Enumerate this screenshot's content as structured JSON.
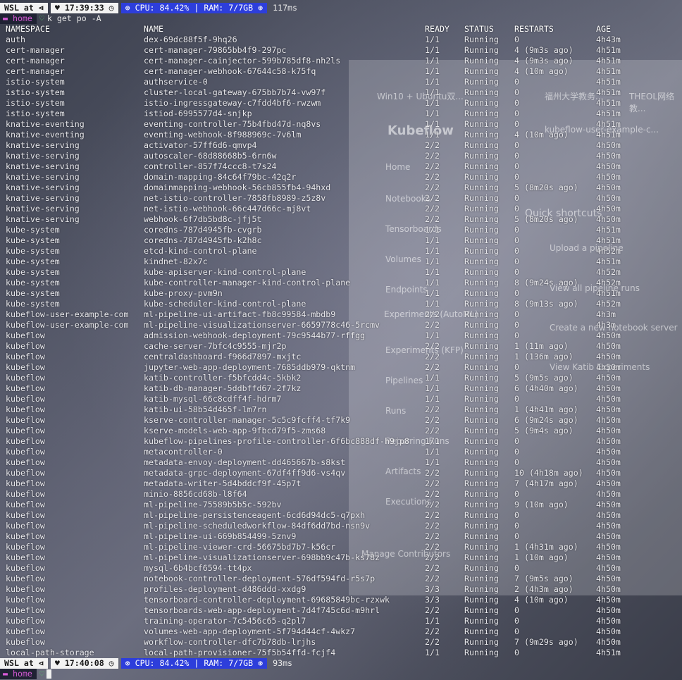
{
  "prompt_top": {
    "wsl": "WSL at",
    "clock": "17:39:33",
    "cpu": "CPU: 84.42% | RAM: 7/7GB",
    "elapsed": "117ms",
    "home": "home",
    "command": "k get po -A"
  },
  "prompt_bottom": {
    "wsl": "WSL at",
    "clock": "17:40:08",
    "cpu": "CPU: 84.42% | RAM: 7/7GB",
    "elapsed": "93ms",
    "home": "home"
  },
  "columns": [
    "NAMESPACE",
    "NAME",
    "READY",
    "STATUS",
    "RESTARTS",
    "AGE"
  ],
  "pods": [
    [
      "auth",
      "dex-69dc88f5f-9hq26",
      "1/1",
      "Running",
      "0",
      "4h43m"
    ],
    [
      "cert-manager",
      "cert-manager-79865bb4f9-297pc",
      "1/1",
      "Running",
      "4 (9m3s ago)",
      "4h51m"
    ],
    [
      "cert-manager",
      "cert-manager-cainjector-599b785df8-nh2ls",
      "1/1",
      "Running",
      "4 (9m3s ago)",
      "4h51m"
    ],
    [
      "cert-manager",
      "cert-manager-webhook-67644c58-k75fq",
      "1/1",
      "Running",
      "4 (10m ago)",
      "4h51m"
    ],
    [
      "istio-system",
      "authservice-0",
      "1/1",
      "Running",
      "0",
      "4h51m"
    ],
    [
      "istio-system",
      "cluster-local-gateway-675bb7b74-vw97f",
      "1/1",
      "Running",
      "0",
      "4h51m"
    ],
    [
      "istio-system",
      "istio-ingressgateway-c7fdd4bf6-rwzwm",
      "1/1",
      "Running",
      "0",
      "4h51m"
    ],
    [
      "istio-system",
      "istiod-6995577d4-snjkp",
      "1/1",
      "Running",
      "0",
      "4h51m"
    ],
    [
      "knative-eventing",
      "eventing-controller-75b4fbd47d-nq8vs",
      "1/1",
      "Running",
      "0",
      "4h51m"
    ],
    [
      "knative-eventing",
      "eventing-webhook-8f988969c-7v6lm",
      "1/1",
      "Running",
      "4 (10m ago)",
      "4h51m"
    ],
    [
      "knative-serving",
      "activator-57ff6d6-qmvp4",
      "2/2",
      "Running",
      "0",
      "4h50m"
    ],
    [
      "knative-serving",
      "autoscaler-68d88668b5-6rn6w",
      "2/2",
      "Running",
      "0",
      "4h50m"
    ],
    [
      "knative-serving",
      "controller-857f74ccc8-t7s24",
      "2/2",
      "Running",
      "0",
      "4h50m"
    ],
    [
      "knative-serving",
      "domain-mapping-84c64f79bc-42q2r",
      "2/2",
      "Running",
      "0",
      "4h50m"
    ],
    [
      "knative-serving",
      "domainmapping-webhook-56cb855fb4-94hxd",
      "2/2",
      "Running",
      "5 (8m20s ago)",
      "4h50m"
    ],
    [
      "knative-serving",
      "net-istio-controller-7858fb8989-z5z8v",
      "2/2",
      "Running",
      "0",
      "4h50m"
    ],
    [
      "knative-serving",
      "net-istio-webhook-66c447d66c-mj8vt",
      "2/2",
      "Running",
      "0",
      "4h50m"
    ],
    [
      "knative-serving",
      "webhook-6f7db5bd8c-jfj5t",
      "2/2",
      "Running",
      "5 (8m20s ago)",
      "4h50m"
    ],
    [
      "kube-system",
      "coredns-787d4945fb-cvgrb",
      "1/1",
      "Running",
      "0",
      "4h51m"
    ],
    [
      "kube-system",
      "coredns-787d4945fb-k2h8c",
      "1/1",
      "Running",
      "0",
      "4h51m"
    ],
    [
      "kube-system",
      "etcd-kind-control-plane",
      "1/1",
      "Running",
      "0",
      "4h52m"
    ],
    [
      "kube-system",
      "kindnet-82x7c",
      "1/1",
      "Running",
      "0",
      "4h51m"
    ],
    [
      "kube-system",
      "kube-apiserver-kind-control-plane",
      "1/1",
      "Running",
      "0",
      "4h52m"
    ],
    [
      "kube-system",
      "kube-controller-manager-kind-control-plane",
      "1/1",
      "Running",
      "8 (9m24s ago)",
      "4h52m"
    ],
    [
      "kube-system",
      "kube-proxy-pvm9n",
      "1/1",
      "Running",
      "0",
      "4h51m"
    ],
    [
      "kube-system",
      "kube-scheduler-kind-control-plane",
      "1/1",
      "Running",
      "8 (9m13s ago)",
      "4h52m"
    ],
    [
      "kubeflow-user-example-com",
      "ml-pipeline-ui-artifact-fb8c99584-mbdb9",
      "2/2",
      "Running",
      "0",
      "4h3m"
    ],
    [
      "kubeflow-user-example-com",
      "ml-pipeline-visualizationserver-6659778c46-5rcmv",
      "2/2",
      "Running",
      "0",
      "4h3m"
    ],
    [
      "kubeflow",
      "admission-webhook-deployment-79c9544b77-rffgg",
      "1/1",
      "Running",
      "0",
      "4h50m"
    ],
    [
      "kubeflow",
      "cache-server-7bfc4c9555-mjr2p",
      "2/2",
      "Running",
      "1 (11m ago)",
      "4h50m"
    ],
    [
      "kubeflow",
      "centraldashboard-f966d7897-mxjtc",
      "2/2",
      "Running",
      "1 (136m ago)",
      "4h50m"
    ],
    [
      "kubeflow",
      "jupyter-web-app-deployment-7685ddb979-qktnm",
      "2/2",
      "Running",
      "0",
      "4h50m"
    ],
    [
      "kubeflow",
      "katib-controller-f5bfcdd4c-5kbk2",
      "1/1",
      "Running",
      "5 (9m5s ago)",
      "4h50m"
    ],
    [
      "kubeflow",
      "katib-db-manager-5ddbffd67-2f7kz",
      "1/1",
      "Running",
      "6 (4h40m ago)",
      "4h50m"
    ],
    [
      "kubeflow",
      "katib-mysql-66c8cdff4f-hdrm7",
      "1/1",
      "Running",
      "0",
      "4h50m"
    ],
    [
      "kubeflow",
      "katib-ui-58b54d465f-lm7rn",
      "2/2",
      "Running",
      "1 (4h41m ago)",
      "4h50m"
    ],
    [
      "kubeflow",
      "kserve-controller-manager-5c5c9fcff4-tf7k9",
      "2/2",
      "Running",
      "6 (9m24s ago)",
      "4h50m"
    ],
    [
      "kubeflow",
      "kserve-models-web-app-9fbcd79f5-zms68",
      "2/2",
      "Running",
      "5 (9m4s ago)",
      "4h50m"
    ],
    [
      "kubeflow",
      "kubeflow-pipelines-profile-controller-6f6bc888df-h9jp8",
      "1/1",
      "Running",
      "0",
      "4h50m"
    ],
    [
      "kubeflow",
      "metacontroller-0",
      "1/1",
      "Running",
      "0",
      "4h50m"
    ],
    [
      "kubeflow",
      "metadata-envoy-deployment-dd465667b-s8kst",
      "1/1",
      "Running",
      "0",
      "4h50m"
    ],
    [
      "kubeflow",
      "metadata-grpc-deployment-67df4ff9d6-vs4qv",
      "2/2",
      "Running",
      "10 (4h18m ago)",
      "4h50m"
    ],
    [
      "kubeflow",
      "metadata-writer-5d4bddcf9f-45p7t",
      "2/2",
      "Running",
      "7 (4h17m ago)",
      "4h50m"
    ],
    [
      "kubeflow",
      "minio-8856cd68b-l8f64",
      "2/2",
      "Running",
      "0",
      "4h50m"
    ],
    [
      "kubeflow",
      "ml-pipeline-75589b5b5c-592bv",
      "2/2",
      "Running",
      "9 (10m ago)",
      "4h50m"
    ],
    [
      "kubeflow",
      "ml-pipeline-persistenceagent-6cd6d94dc5-q7pxh",
      "2/2",
      "Running",
      "0",
      "4h50m"
    ],
    [
      "kubeflow",
      "ml-pipeline-scheduledworkflow-84df6dd7bd-nsn9v",
      "2/2",
      "Running",
      "0",
      "4h50m"
    ],
    [
      "kubeflow",
      "ml-pipeline-ui-669b854499-5znv9",
      "2/2",
      "Running",
      "0",
      "4h50m"
    ],
    [
      "kubeflow",
      "ml-pipeline-viewer-crd-56675bd7b7-k56cr",
      "2/2",
      "Running",
      "1 (4h31m ago)",
      "4h50m"
    ],
    [
      "kubeflow",
      "ml-pipeline-visualizationserver-698bb9c47b-ks78z",
      "2/2",
      "Running",
      "1 (10m ago)",
      "4h50m"
    ],
    [
      "kubeflow",
      "mysql-6b4bcf6594-tt4px",
      "2/2",
      "Running",
      "0",
      "4h50m"
    ],
    [
      "kubeflow",
      "notebook-controller-deployment-576df594fd-r5s7p",
      "2/2",
      "Running",
      "7 (9m5s ago)",
      "4h50m"
    ],
    [
      "kubeflow",
      "profiles-deployment-d486ddd-xxdg9",
      "3/3",
      "Running",
      "2 (4h3m ago)",
      "4h50m"
    ],
    [
      "kubeflow",
      "tensorboard-controller-deployment-69685849bc-rzxwk",
      "3/3",
      "Running",
      "4 (10m ago)",
      "4h50m"
    ],
    [
      "kubeflow",
      "tensorboards-web-app-deployment-7d4f745c6d-m9hrl",
      "2/2",
      "Running",
      "0",
      "4h50m"
    ],
    [
      "kubeflow",
      "training-operator-7c5456c65-q2pl7",
      "1/1",
      "Running",
      "0",
      "4h50m"
    ],
    [
      "kubeflow",
      "volumes-web-app-deployment-5f794d44cf-4wkz7",
      "2/2",
      "Running",
      "0",
      "4h50m"
    ],
    [
      "kubeflow",
      "workflow-controller-dfc7b78db-lrjhs",
      "2/2",
      "Running",
      "7 (9m29s ago)",
      "4h50m"
    ],
    [
      "local-path-storage",
      "local-path-provisioner-75f5b54ffd-fcjf4",
      "1/1",
      "Running",
      "0",
      "4h51m"
    ]
  ],
  "background_overlay": {
    "tabs": [
      "Win10 + Ubuntu双...",
      "福州大学教务...",
      "THEOL网络教..."
    ],
    "app_name": "Kubeflow",
    "namespace": "kubeflow-user-example-c...",
    "nav": [
      "Home",
      "Notebooks",
      "Tensorboards",
      "Volumes",
      "Endpoints",
      "Experiments (AutoML)",
      "Experiments (KFP)",
      "Pipelines",
      "Runs",
      "Recurring Runs",
      "Artifacts",
      "Executions",
      "Manage Contributors"
    ],
    "quick_shortcuts_title": "Quick shortcuts",
    "shortcuts": [
      "Upload a pipeline",
      "View all pipeline runs",
      "Create a new notebook server",
      "View Katib Experiments"
    ]
  }
}
